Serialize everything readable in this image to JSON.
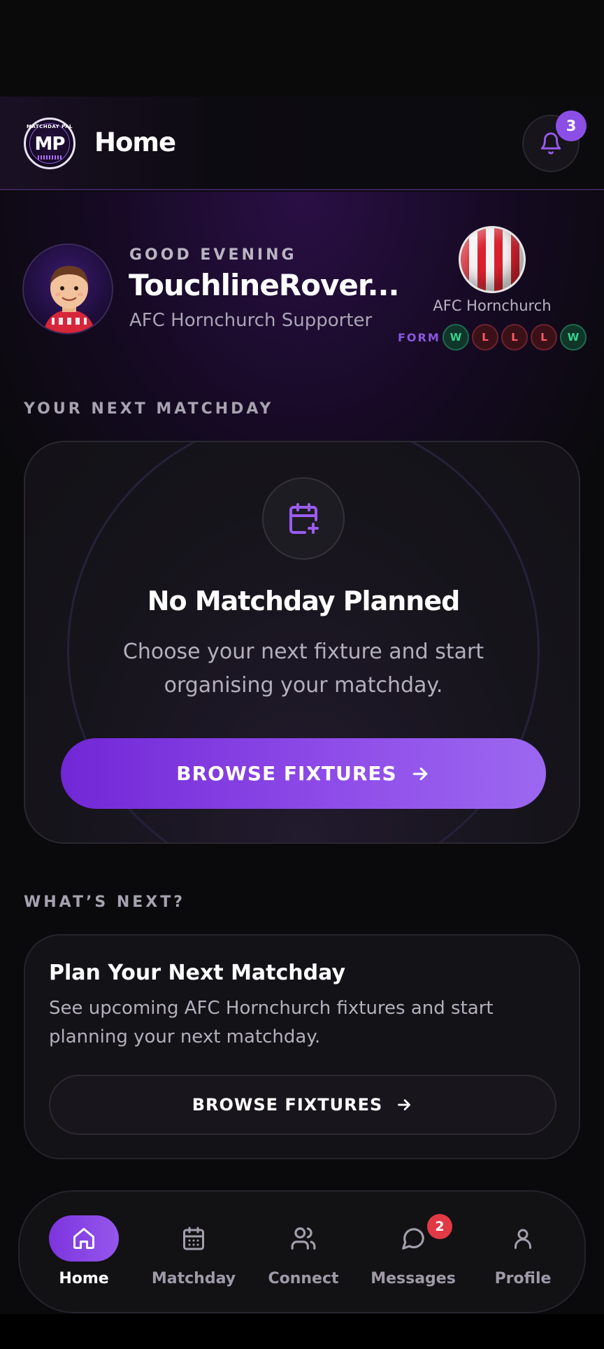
{
  "header": {
    "logo_text": "MP",
    "logo_arc_text": "MATCHDAY PAL",
    "title": "Home",
    "notification_count": "3"
  },
  "profile": {
    "greeting": "GOOD EVENING",
    "username": "TouchlineRover...",
    "supporter": "AFC Hornchurch Supporter"
  },
  "club": {
    "name": "AFC Hornchurch",
    "form_label": "FORM",
    "form": [
      "W",
      "L",
      "L",
      "L",
      "W"
    ],
    "colors": {
      "primary": "#d9212e",
      "secondary": "#f4f4f4"
    }
  },
  "next_matchday": {
    "section_label": "YOUR NEXT MATCHDAY",
    "title": "No Matchday Planned",
    "text": "Choose your next fixture and start organising your matchday.",
    "button_label": "BROWSE FIXTURES"
  },
  "whats_next": {
    "section_label": "WHAT’S NEXT?",
    "title": "Plan Your Next Matchday",
    "text": "See upcoming AFC Hornchurch fixtures and start planning your next matchday.",
    "button_label": "BROWSE FIXTURES"
  },
  "nav": {
    "items": [
      {
        "label": "Home",
        "icon": "home-icon"
      },
      {
        "label": "Matchday",
        "icon": "calendar-icon"
      },
      {
        "label": "Connect",
        "icon": "users-icon"
      },
      {
        "label": "Messages",
        "icon": "chat-icon"
      },
      {
        "label": "Profile",
        "icon": "user-icon"
      }
    ],
    "messages_badge": "2"
  },
  "colors": {
    "accent": "#8b4fe6",
    "win": "#39d38f",
    "loss": "#ff5a6c",
    "badge_red": "#e23a45"
  }
}
